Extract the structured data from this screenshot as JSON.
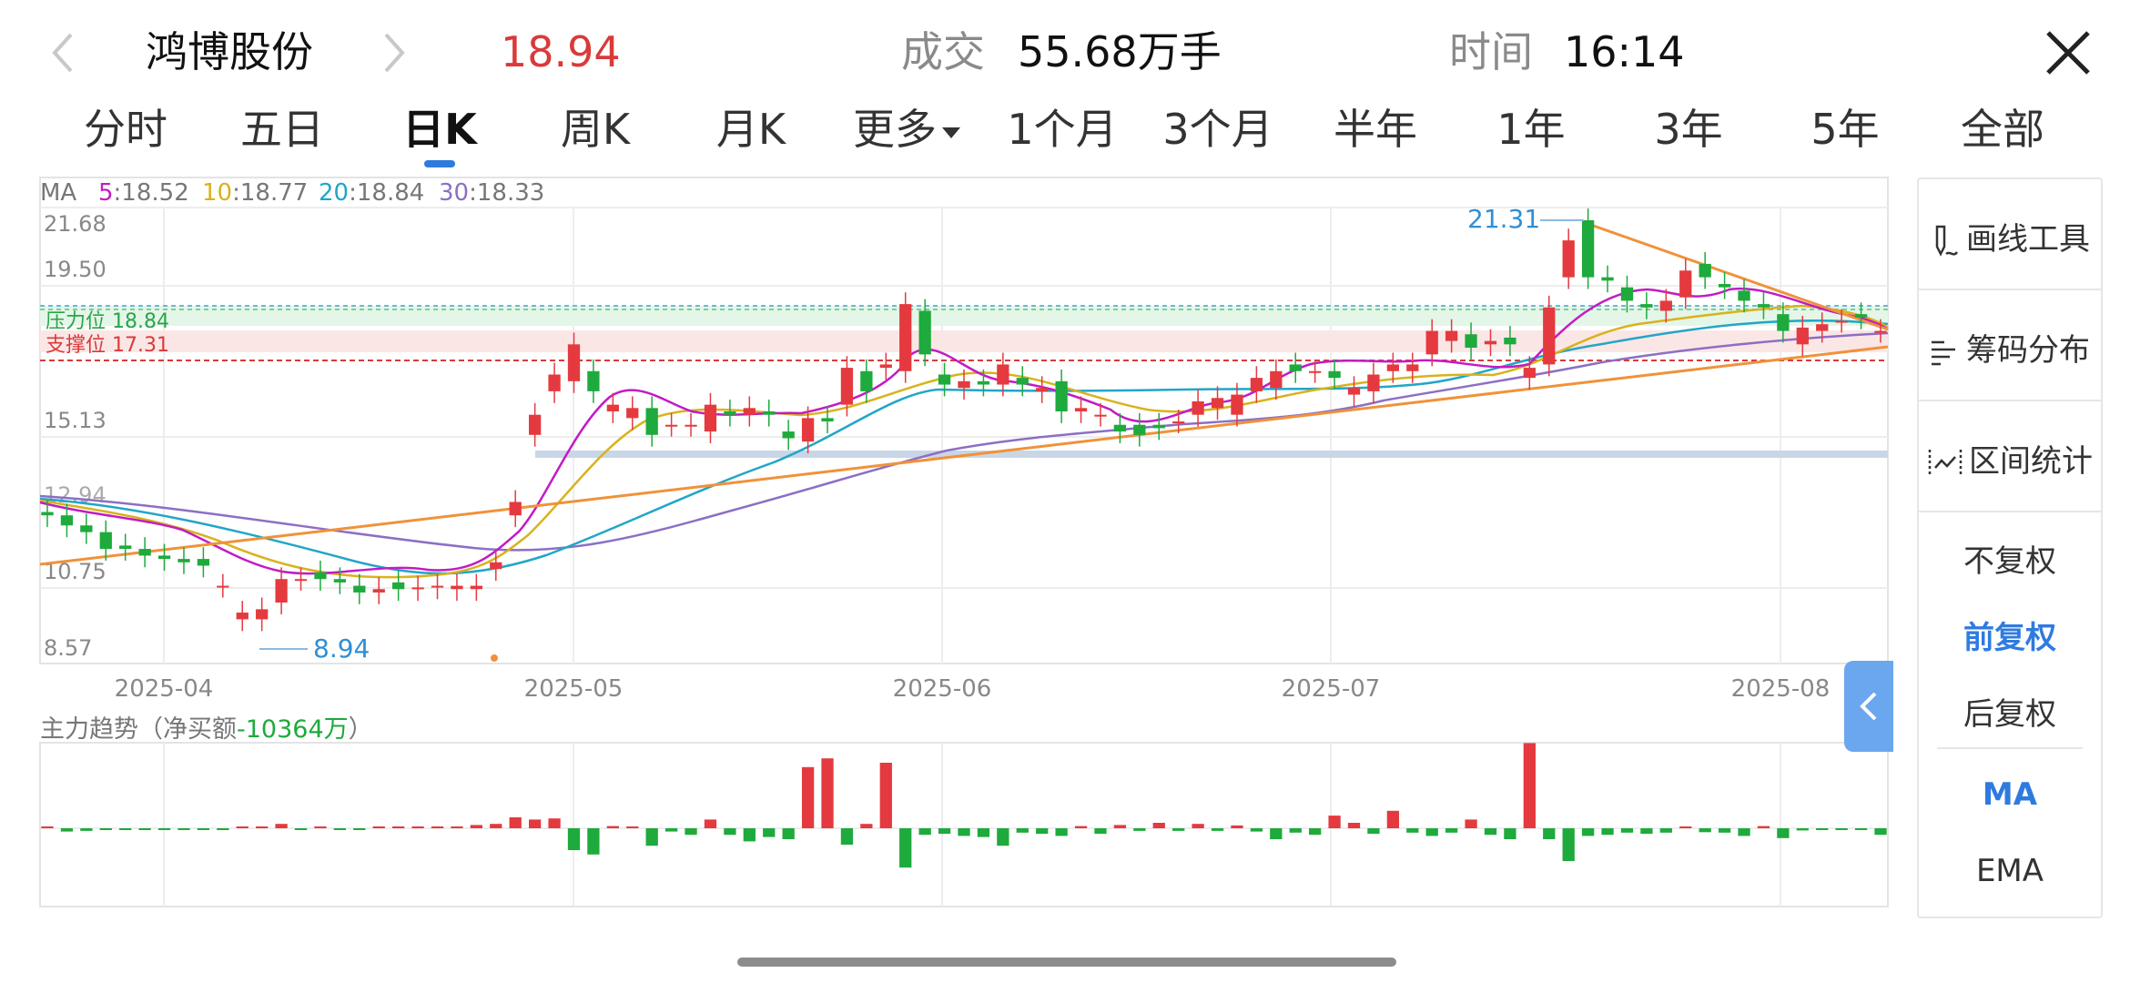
{
  "header": {
    "stock_name": "鸿博股份",
    "price": "18.94",
    "volume_label": "成交",
    "volume_value": "55.68万手",
    "time_label": "时间",
    "time_value": "16:14"
  },
  "tabs": [
    "分时",
    "五日",
    "日K",
    "周K",
    "月K",
    "更多",
    "1个月",
    "3个月",
    "半年",
    "1年",
    "3年",
    "5年",
    "全部"
  ],
  "active_tab": "日K",
  "ma_legend": {
    "label": "MA",
    "items": [
      {
        "key": "5",
        "value": ":18.52",
        "color": "#c21bc4"
      },
      {
        "key": "10",
        "value": ":18.77",
        "color": "#d9b21c"
      },
      {
        "key": "20",
        "value": ":18.84",
        "color": "#21a6c7"
      },
      {
        "key": "30",
        "value": ":18.33",
        "color": "#8c6fc4"
      }
    ]
  },
  "levels": {
    "resistance_label": "压力位 18.84",
    "support_label": "支撑位 17.31"
  },
  "flow": {
    "title": "主力趋势（净买额",
    "value": "-10364万",
    "close": "）"
  },
  "right_panel": {
    "draw_tool": "画线工具",
    "chip_dist": "筹码分布",
    "range_stats": "区间统计",
    "no_adjust": "不复权",
    "forward_adjust": "前复权",
    "backward_adjust": "后复权",
    "ma": "MA",
    "ema": "EMA"
  },
  "colors": {
    "up": "#e43a3f",
    "down": "#1eaa3c",
    "accent": "#2e7be0",
    "trendline": "#f0923a"
  },
  "chart_data": {
    "type": "candlestick",
    "y_axis_ticks": [
      "21.68",
      "19.50",
      "15.13",
      "12.94",
      "10.75",
      "8.57"
    ],
    "x_axis_ticks": [
      "2025-04",
      "2025-05",
      "2025-06",
      "2025-07",
      "2025-08"
    ],
    "high_annotation": "21.31",
    "low_annotation": "8.94",
    "resistance": 18.84,
    "support": 17.31,
    "candles": [
      {
        "o": 12.6,
        "c": 12.5
      },
      {
        "o": 12.5,
        "c": 12.2
      },
      {
        "o": 12.2,
        "c": 12.0
      },
      {
        "o": 12.0,
        "c": 11.5
      },
      {
        "o": 11.6,
        "c": 11.5
      },
      {
        "o": 11.5,
        "c": 11.3
      },
      {
        "o": 11.3,
        "c": 11.2
      },
      {
        "o": 11.2,
        "c": 11.1
      },
      {
        "o": 11.2,
        "c": 11.0
      },
      {
        "o": 10.4,
        "c": 10.4
      },
      {
        "o": 9.4,
        "c": 9.6
      },
      {
        "o": 9.4,
        "c": 9.7
      },
      {
        "o": 9.9,
        "c": 10.6
      },
      {
        "o": 10.6,
        "c": 10.6
      },
      {
        "o": 10.8,
        "c": 10.6
      },
      {
        "o": 10.6,
        "c": 10.5
      },
      {
        "o": 10.4,
        "c": 10.2
      },
      {
        "o": 10.2,
        "c": 10.3
      },
      {
        "o": 10.5,
        "c": 10.3
      },
      {
        "o": 10.3,
        "c": 10.35
      },
      {
        "o": 10.35,
        "c": 10.4
      },
      {
        "o": 10.3,
        "c": 10.4
      },
      {
        "o": 10.3,
        "c": 10.4
      },
      {
        "o": 10.9,
        "c": 11.1
      },
      {
        "o": 12.5,
        "c": 12.9
      },
      {
        "o": 14.9,
        "c": 15.5
      },
      {
        "o": 16.2,
        "c": 16.7
      },
      {
        "o": 16.5,
        "c": 17.6
      },
      {
        "o": 16.8,
        "c": 16.2
      },
      {
        "o": 15.6,
        "c": 15.8
      },
      {
        "o": 15.4,
        "c": 15.7
      },
      {
        "o": 15.7,
        "c": 14.9
      },
      {
        "o": 15.2,
        "c": 15.2
      },
      {
        "o": 15.2,
        "c": 15.2
      },
      {
        "o": 15.0,
        "c": 15.8
      },
      {
        "o": 15.6,
        "c": 15.5
      },
      {
        "o": 15.5,
        "c": 15.7
      },
      {
        "o": 15.6,
        "c": 15.5
      },
      {
        "o": 15.0,
        "c": 14.8
      },
      {
        "o": 14.7,
        "c": 15.4
      },
      {
        "o": 15.4,
        "c": 15.3
      },
      {
        "o": 15.8,
        "c": 16.9
      },
      {
        "o": 16.8,
        "c": 16.2
      },
      {
        "o": 16.9,
        "c": 17.0
      },
      {
        "o": 16.8,
        "c": 18.8
      },
      {
        "o": 18.6,
        "c": 17.3
      },
      {
        "o": 16.7,
        "c": 16.4
      },
      {
        "o": 16.3,
        "c": 16.5
      },
      {
        "o": 16.5,
        "c": 16.4
      },
      {
        "o": 16.4,
        "c": 17.0
      },
      {
        "o": 16.6,
        "c": 16.4
      },
      {
        "o": 16.2,
        "c": 16.3
      },
      {
        "o": 16.5,
        "c": 15.6
      },
      {
        "o": 15.6,
        "c": 15.7
      },
      {
        "o": 15.5,
        "c": 15.5
      },
      {
        "o": 15.2,
        "c": 15.0
      },
      {
        "o": 15.2,
        "c": 14.9
      },
      {
        "o": 15.2,
        "c": 15.1
      },
      {
        "o": 15.3,
        "c": 15.3
      },
      {
        "o": 15.5,
        "c": 15.9
      },
      {
        "o": 15.7,
        "c": 16.0
      },
      {
        "o": 15.5,
        "c": 16.1
      },
      {
        "o": 16.2,
        "c": 16.6
      },
      {
        "o": 16.3,
        "c": 16.8
      },
      {
        "o": 17.0,
        "c": 16.8
      },
      {
        "o": 16.8,
        "c": 16.8
      },
      {
        "o": 16.8,
        "c": 16.6
      },
      {
        "o": 16.1,
        "c": 16.3
      },
      {
        "o": 16.2,
        "c": 16.7
      },
      {
        "o": 16.8,
        "c": 17.0
      },
      {
        "o": 16.8,
        "c": 17.0
      },
      {
        "o": 17.3,
        "c": 18.0
      },
      {
        "o": 17.7,
        "c": 18.0
      },
      {
        "o": 17.9,
        "c": 17.5
      },
      {
        "o": 17.6,
        "c": 17.7
      },
      {
        "o": 17.8,
        "c": 17.6
      },
      {
        "o": 16.6,
        "c": 16.9
      },
      {
        "o": 17.0,
        "c": 18.7
      },
      {
        "o": 19.6,
        "c": 20.7
      },
      {
        "o": 21.3,
        "c": 19.6
      },
      {
        "o": 19.6,
        "c": 19.5
      },
      {
        "o": 19.3,
        "c": 18.9
      },
      {
        "o": 18.8,
        "c": 18.7
      },
      {
        "o": 18.6,
        "c": 18.9
      },
      {
        "o": 19.0,
        "c": 19.8
      },
      {
        "o": 20.0,
        "c": 19.6
      },
      {
        "o": 19.4,
        "c": 19.3
      },
      {
        "o": 19.2,
        "c": 18.9
      },
      {
        "o": 18.8,
        "c": 18.7
      },
      {
        "o": 18.5,
        "c": 18.0
      },
      {
        "o": 17.6,
        "c": 18.1
      },
      {
        "o": 18.0,
        "c": 18.2
      },
      {
        "o": 18.3,
        "c": 18.3
      },
      {
        "o": 18.5,
        "c": 18.4
      },
      {
        "o": 18.0,
        "c": 18.0
      }
    ],
    "net_flow_wan": [
      50,
      -150,
      -120,
      -80,
      -50,
      -40,
      -40,
      -60,
      -70,
      -30,
      20,
      30,
      200,
      -20,
      20,
      -60,
      -40,
      30,
      20,
      20,
      60,
      50,
      150,
      200,
      500,
      400,
      450,
      -1000,
      -1200,
      100,
      50,
      -800,
      -150,
      -300,
      400,
      -300,
      -600,
      -400,
      -500,
      2800,
      3200,
      -750,
      200,
      3000,
      -1800,
      -300,
      -250,
      -350,
      -400,
      -800,
      -200,
      -250,
      -350,
      100,
      -250,
      150,
      -120,
      250,
      -120,
      200,
      -120,
      130,
      -150,
      -500,
      -200,
      -300,
      580,
      250,
      -250,
      800,
      -200,
      -350,
      -200,
      400,
      -300,
      -500,
      3900,
      -500,
      -1500,
      -350,
      -300,
      -200,
      -250,
      -200,
      80,
      -180,
      -200,
      -350,
      100,
      -450,
      -100,
      -50,
      -80,
      -60,
      -300
    ]
  }
}
